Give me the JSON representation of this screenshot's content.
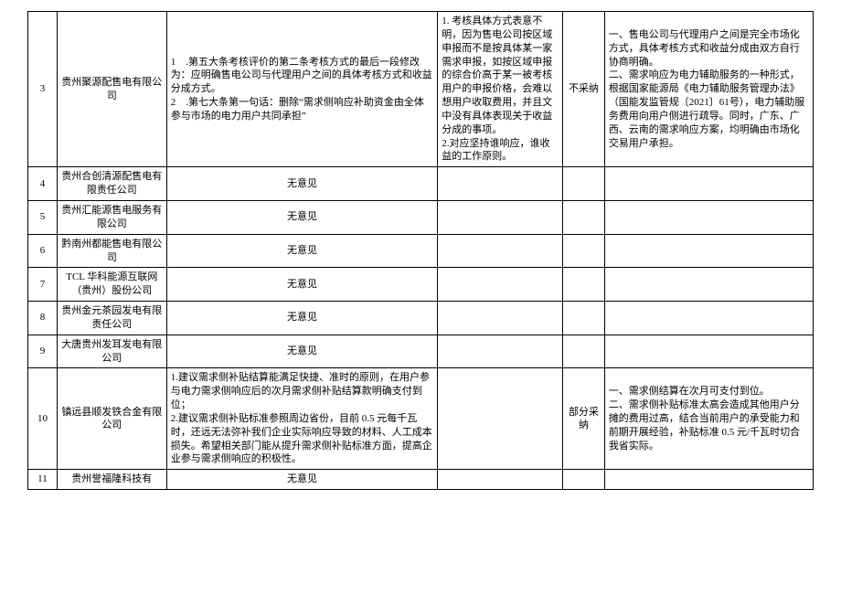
{
  "rows": [
    {
      "idx": "3",
      "org": "贵州聚源配售电有限公司",
      "opinion": "1 .第五大条考核评价的第二条考核方式的最后一段修改为：应明确售电公司与代理用户之间的具体考核方式和收益分成方式。\n2 .第七大条第一句话：删除“需求侧响应补助资金由全体参与市场的电力用户共同承担”",
      "internal": "1. 考核具体方式表意不明，因为售电公司按区域申报而不是按具体某一家需求申报，如按区域申报的综合价高于某一被考核用户的申报价格，会难以想用户收取费用，并且文中没有具体表现关于收益分成的事项。\n2.对应坚持谁响应，谁收益的工作原则。",
      "adopt": "不采纳",
      "response": "一、售电公司与代理用户之间是完全市场化方式，具体考核方式和收益分成由双方自行协商明确。\n二、需求响应为电力辅助服务的一种形式，根据国家能源局《电力辅助服务管理办法》\n（国能发监管规〔2021〕61号），电力辅助服务费用向用户侧进行疏导。同时，广东、广西、云南的需求响应方案，均明确由市场化交易用户承担。"
    },
    {
      "idx": "4",
      "org": "贵州合创清源配售电有限责任公司",
      "opinion_center": "无意见"
    },
    {
      "idx": "5",
      "org": "贵州汇能源售电服务有限公司",
      "opinion_center": "无意见"
    },
    {
      "idx": "6",
      "org": "黔南州都能售电有限公司",
      "opinion_center": "无意见"
    },
    {
      "idx": "7",
      "org": "TCL 华科能源互联网（贵州）股份公司",
      "opinion_center": "无意见"
    },
    {
      "idx": "8",
      "org": "贵州金元茶园发电有限责任公司",
      "opinion_center": "无意见"
    },
    {
      "idx": "9",
      "org": "大唐贵州发耳发电有限公司",
      "opinion_center": "无意见"
    },
    {
      "idx": "10",
      "org": "镇远县顺发铁合金有限公司",
      "opinion": "1.建议需求侧补贴结算能满足快捷、准时的原则，在用户参与电力需求侧响应后的次月需求侧补贴结算款明确支付到位；\n2.建议需求侧补贴标准参照周边省份，目前 0.5 元每千瓦时，还远无法弥补我们企业实际响应导致的材料、人工成本损失。希望相关部门能从提升需求侧补贴标准方面，提高企业参与需求侧响应的积极性。",
      "internal": "",
      "adopt": "部分采纳",
      "response": "一、需求侧结算在次月可支付到位。\n二、需求侧补贴标准太高会造成其他用户分摊的费用过高，结合当前用户的承受能力和前期开展经验，补贴标准 0.5 元/千瓦时切合我省实际。"
    },
    {
      "idx": "11",
      "org": "贵州誉福隆科技有",
      "opinion_center": "无意见"
    }
  ]
}
